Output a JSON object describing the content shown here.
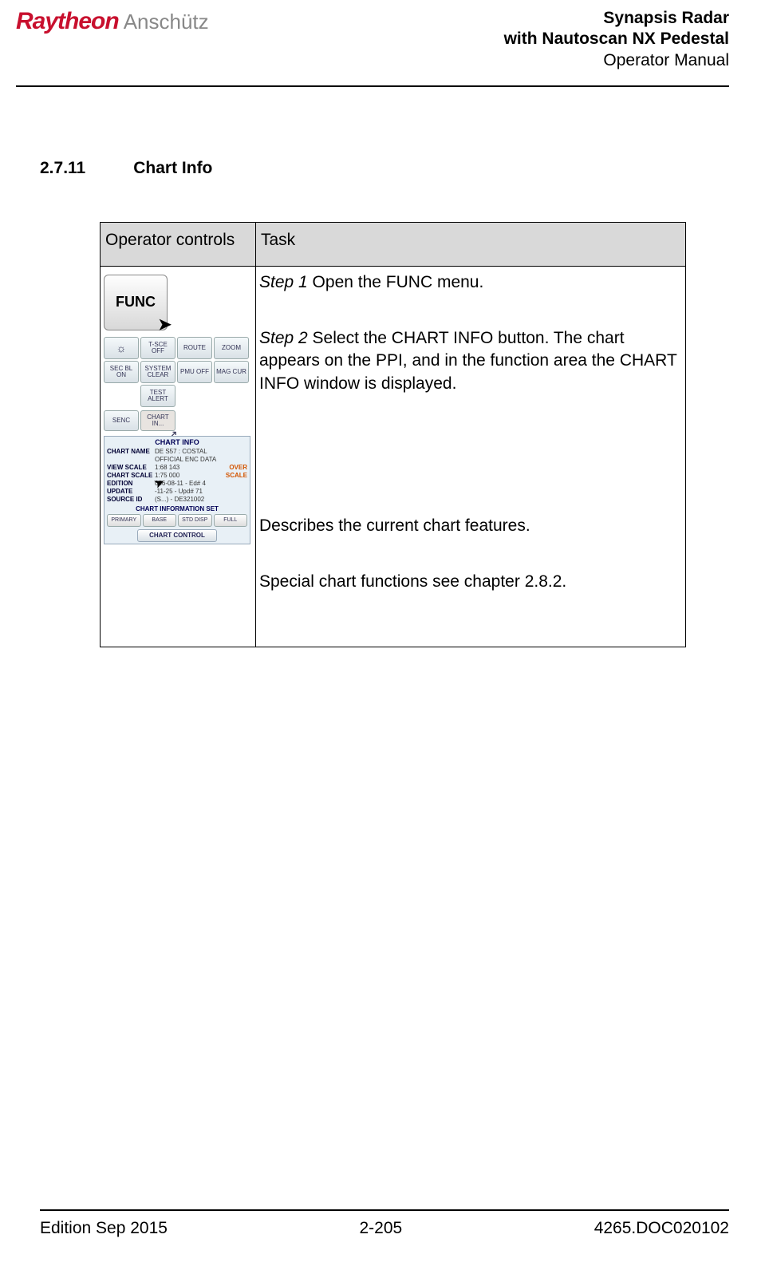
{
  "header": {
    "logo_raytheon": "Raytheon",
    "logo_anschutz": "Anschütz",
    "title_l1": "Synapsis Radar",
    "title_l2": "with Nautoscan NX Pedestal",
    "title_l3": "Operator Manual"
  },
  "section": {
    "number": "2.7.11",
    "title": "Chart Info"
  },
  "table": {
    "head_op": "Operator controls",
    "head_task": "Task",
    "steps": {
      "s1_label": "Step 1",
      "s1_text": " Open the FUNC menu.",
      "s2_label": "Step 2",
      "s2_text": " Select the CHART INFO button. The chart appears on the PPI, and in the function area the CHART INFO window is displayed.",
      "desc": "Describes the current chart features.",
      "ref": "Special chart functions see chapter 2.8.2."
    }
  },
  "controls": {
    "func": "FUNC",
    "grid": {
      "tsce": "T-SCE OFF",
      "route": "ROUTE",
      "zoom": "ZOOM",
      "secbl": "SEC BL ON",
      "sysclear": "SYSTEM CLEAR",
      "pmu": "PMU OFF",
      "magcur": "MAG CUR",
      "testalert": "TEST ALERT"
    },
    "senc": "SENC",
    "chartin": "CHART IN...",
    "panel": {
      "title": "CHART INFO",
      "rows": {
        "chart_name_k": "CHART NAME",
        "chart_name_v": "DE S57 : COSTAL",
        "official": "OFFICIAL ENC DATA",
        "view_scale_k": "VIEW SCALE",
        "view_scale_v": "1:68 143",
        "over": "OVER",
        "chart_scale_k": "CHART SCALE",
        "chart_scale_v": "1:75 000",
        "scale": "SCALE",
        "edition_k": "EDITION",
        "edition_v": "006-08-11 - Ed#  4",
        "update_k": "UPDATE",
        "update_v": "-11-25 - Upd# 71",
        "source_k": "SOURCE ID",
        "source_v": "(S...) - DE321002"
      },
      "set_title": "CHART INFORMATION SET",
      "presets": {
        "primary": "PRIMARY",
        "base": "BASE",
        "std": "STD DISP",
        "full": "FULL"
      },
      "chart_control": "CHART CONTROL"
    }
  },
  "footer": {
    "left": "Edition Sep 2015",
    "center": "2-205",
    "right": "4265.DOC020102"
  }
}
